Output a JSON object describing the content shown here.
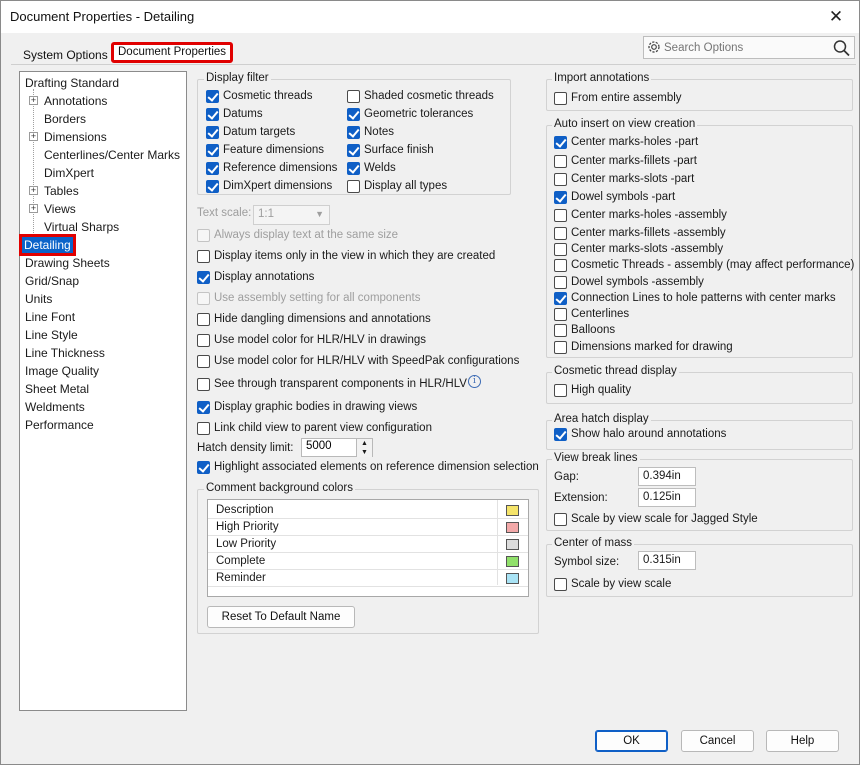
{
  "window": {
    "title": "Document Properties - Detailing",
    "close_label": "✕"
  },
  "tabs": {
    "system": "System Options",
    "document": "Document Properties"
  },
  "search": {
    "placeholder": "Search Options"
  },
  "tree": {
    "root": "Drafting Standard",
    "children": [
      "Annotations",
      "Borders",
      "Dimensions",
      "Centerlines/Center Marks",
      "DimXpert",
      "Tables",
      "Views",
      "Virtual Sharps"
    ],
    "items": [
      "Detailing",
      "Drawing Sheets",
      "Grid/Snap",
      "Units",
      "Line Font",
      "Line Style",
      "Line Thickness",
      "Image Quality",
      "Sheet Metal",
      "Weldments",
      "Performance"
    ]
  },
  "display_filter": {
    "title": "Display filter",
    "left": [
      {
        "label": "Cosmetic threads",
        "checked": true
      },
      {
        "label": "Datums",
        "checked": true
      },
      {
        "label": "Datum targets",
        "checked": true
      },
      {
        "label": "Feature dimensions",
        "checked": true
      },
      {
        "label": "Reference dimensions",
        "checked": true
      },
      {
        "label": "DimXpert dimensions",
        "checked": true
      }
    ],
    "right": [
      {
        "label": "Shaded cosmetic threads",
        "checked": false
      },
      {
        "label": "Geometric tolerances",
        "checked": true
      },
      {
        "label": "Notes",
        "checked": true
      },
      {
        "label": "Surface finish",
        "checked": true
      },
      {
        "label": "Welds",
        "checked": true
      },
      {
        "label": "Display all types",
        "checked": false
      }
    ]
  },
  "text_scale": {
    "label": "Text scale:",
    "value": "1:1"
  },
  "options": [
    {
      "label": "Always display text at the same size",
      "checked": false,
      "disabled": true
    },
    {
      "label": "Display items only in the view in which they are created",
      "checked": false
    },
    {
      "label": "Display annotations",
      "checked": true
    },
    {
      "label": "Use assembly setting for all components",
      "checked": false,
      "disabled": true
    },
    {
      "label": "Hide dangling dimensions and annotations",
      "checked": false
    },
    {
      "label": "Use model color for HLR/HLV in drawings",
      "checked": false
    },
    {
      "label": "Use model color for HLR/HLV with SpeedPak configurations",
      "checked": false
    },
    {
      "label": "See through transparent components in HLR/HLV",
      "checked": false
    },
    {
      "label": "Display graphic bodies in drawing views",
      "checked": true
    },
    {
      "label": "Link child view to parent view configuration",
      "checked": false
    }
  ],
  "hatch": {
    "label": "Hatch density limit:",
    "value": "5000"
  },
  "highlight": {
    "label": "Highlight associated elements on reference dimension selection",
    "checked": true
  },
  "comment_colors": {
    "title": "Comment background colors",
    "rows": [
      {
        "name": "Description",
        "color": "#f5e46a"
      },
      {
        "name": "High Priority",
        "color": "#f3a9a9"
      },
      {
        "name": "Low Priority",
        "color": "#dcdcdc"
      },
      {
        "name": "Complete",
        "color": "#90e06a"
      },
      {
        "name": "Reminder",
        "color": "#a9e3f5"
      }
    ],
    "reset_label": "Reset To Default Name"
  },
  "import_annotations": {
    "title": "Import annotations",
    "entire": {
      "label": "From entire assembly",
      "checked": false
    }
  },
  "auto_insert": {
    "title": "Auto insert on view creation",
    "items": [
      {
        "label": "Center marks-holes -part",
        "checked": true
      },
      {
        "label": "Center marks-fillets -part",
        "checked": false
      },
      {
        "label": "Center marks-slots  -part",
        "checked": false
      },
      {
        "label": "Dowel symbols -part",
        "checked": true
      },
      {
        "label": "Center marks-holes -assembly",
        "checked": false
      },
      {
        "label": "Center marks-fillets -assembly",
        "checked": false
      },
      {
        "label": "Center marks-slots  -assembly",
        "checked": false
      },
      {
        "label": "Cosmetic Threads - assembly (may affect performance)",
        "checked": false
      },
      {
        "label": "Dowel symbols -assembly",
        "checked": false
      },
      {
        "label": "Connection Lines to hole patterns with center marks",
        "checked": true
      },
      {
        "label": "Centerlines",
        "checked": false
      },
      {
        "label": "Balloons",
        "checked": false
      },
      {
        "label": "Dimensions marked for drawing",
        "checked": false
      }
    ]
  },
  "cosmetic_display": {
    "title": "Cosmetic thread display",
    "high_quality": {
      "label": "High quality",
      "checked": false
    }
  },
  "area_hatch": {
    "title": "Area hatch display",
    "halo": {
      "label": "Show halo around annotations",
      "checked": true
    }
  },
  "view_break": {
    "title": "View break lines",
    "gap_label": "Gap:",
    "gap": "0.394in",
    "ext_label": "Extension:",
    "ext": "0.125in",
    "scale": {
      "label": "Scale by view scale for Jagged Style",
      "checked": false
    }
  },
  "center_mass": {
    "title": "Center of mass",
    "size_label": "Symbol size:",
    "size": "0.315in",
    "scale": {
      "label": "Scale by view scale",
      "checked": false
    }
  },
  "buttons": {
    "ok": "OK",
    "cancel": "Cancel",
    "help": "Help"
  }
}
